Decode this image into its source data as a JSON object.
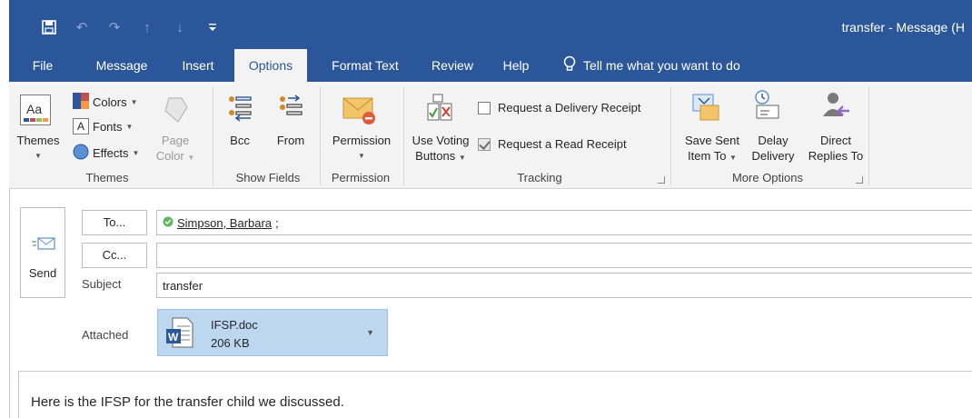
{
  "window": {
    "title": "transfer  -  Message (H"
  },
  "qat": {
    "save": "▣",
    "undo": "↶",
    "redo": "↷",
    "up": "↑",
    "down": "↓",
    "customize": "⫧"
  },
  "tabs": [
    {
      "label": "File"
    },
    {
      "label": "Message"
    },
    {
      "label": "Insert"
    },
    {
      "label": "Options"
    },
    {
      "label": "Format Text"
    },
    {
      "label": "Review"
    },
    {
      "label": "Help"
    }
  ],
  "active_tab": "Options",
  "tell_me": "Tell me what you want to do",
  "ribbon": {
    "themes": {
      "themes_label": "Themes",
      "colors_label": "Colors",
      "fonts_label": "Fonts",
      "effects_label": "Effects",
      "page_label": "Page",
      "color_label": "Color",
      "group_label": "Themes"
    },
    "show_fields": {
      "bcc_label": "Bcc",
      "from_label": "From",
      "group_label": "Show Fields"
    },
    "permission": {
      "permission_label": "Permission",
      "group_label": "Permission"
    },
    "tracking": {
      "voting_line1": "Use Voting",
      "voting_line2": "Buttons",
      "delivery_receipt": "Request a Delivery Receipt",
      "delivery_checked": false,
      "read_receipt": "Request a Read Receipt",
      "read_checked": true,
      "group_label": "Tracking"
    },
    "more_options": {
      "save_sent_line1": "Save Sent",
      "save_sent_line2": "Item To",
      "delay_line1": "Delay",
      "delay_line2": "Delivery",
      "direct_line1": "Direct",
      "direct_line2": "Replies To",
      "group_label": "More Options"
    }
  },
  "compose": {
    "send_label": "Send",
    "to_button": "To...",
    "cc_button": "Cc...",
    "to_recipient": "Simpson, Barbara",
    "to_separator": ";",
    "cc_value": "",
    "subject_label": "Subject",
    "subject_value": "transfer",
    "attached_label": "Attached",
    "attachment": {
      "name": "IFSP.doc",
      "size": "206 KB"
    },
    "body_text": "Here is the IFSP for the transfer child we discussed."
  },
  "colors": {
    "title_bar": "#2b579a",
    "ribbon_bg": "#f3f3f3",
    "attachment_bg": "#bcd7ef",
    "presence_green": "#5cb85c"
  }
}
